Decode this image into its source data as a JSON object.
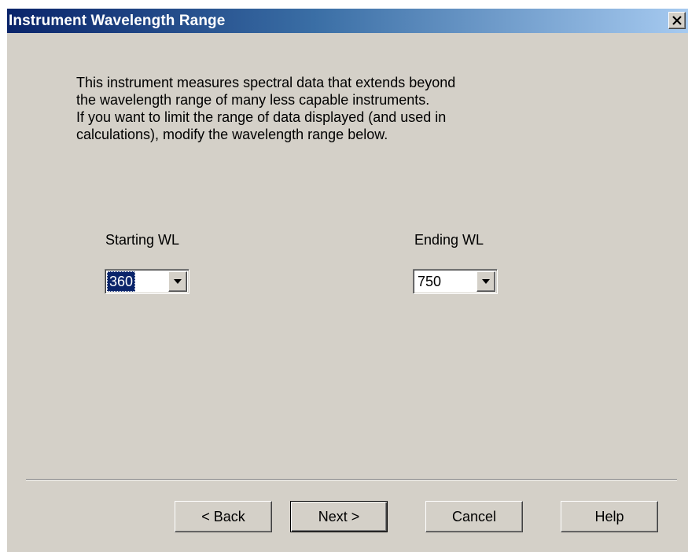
{
  "window": {
    "title": "Instrument Wavelength Range",
    "close_icon": "close-icon"
  },
  "description": "This instrument measures spectral data that extends beyond\nthe wavelength range of many less capable instruments.\n If you want to limit the range of data displayed (and used in\ncalculations), modify the wavelength range below.",
  "starting_wl": {
    "label": "Starting WL",
    "value": "360",
    "icon": "chevron-down-icon"
  },
  "ending_wl": {
    "label": "Ending WL",
    "value": "750",
    "icon": "chevron-down-icon"
  },
  "buttons": {
    "back": "< Back",
    "next": "Next >",
    "cancel": "Cancel",
    "help": "Help"
  },
  "colors": {
    "title_bar_start": "#0a246a",
    "title_bar_end": "#a6caf0",
    "dialog_background": "#d4d0c8",
    "selection": "#0a246a"
  }
}
